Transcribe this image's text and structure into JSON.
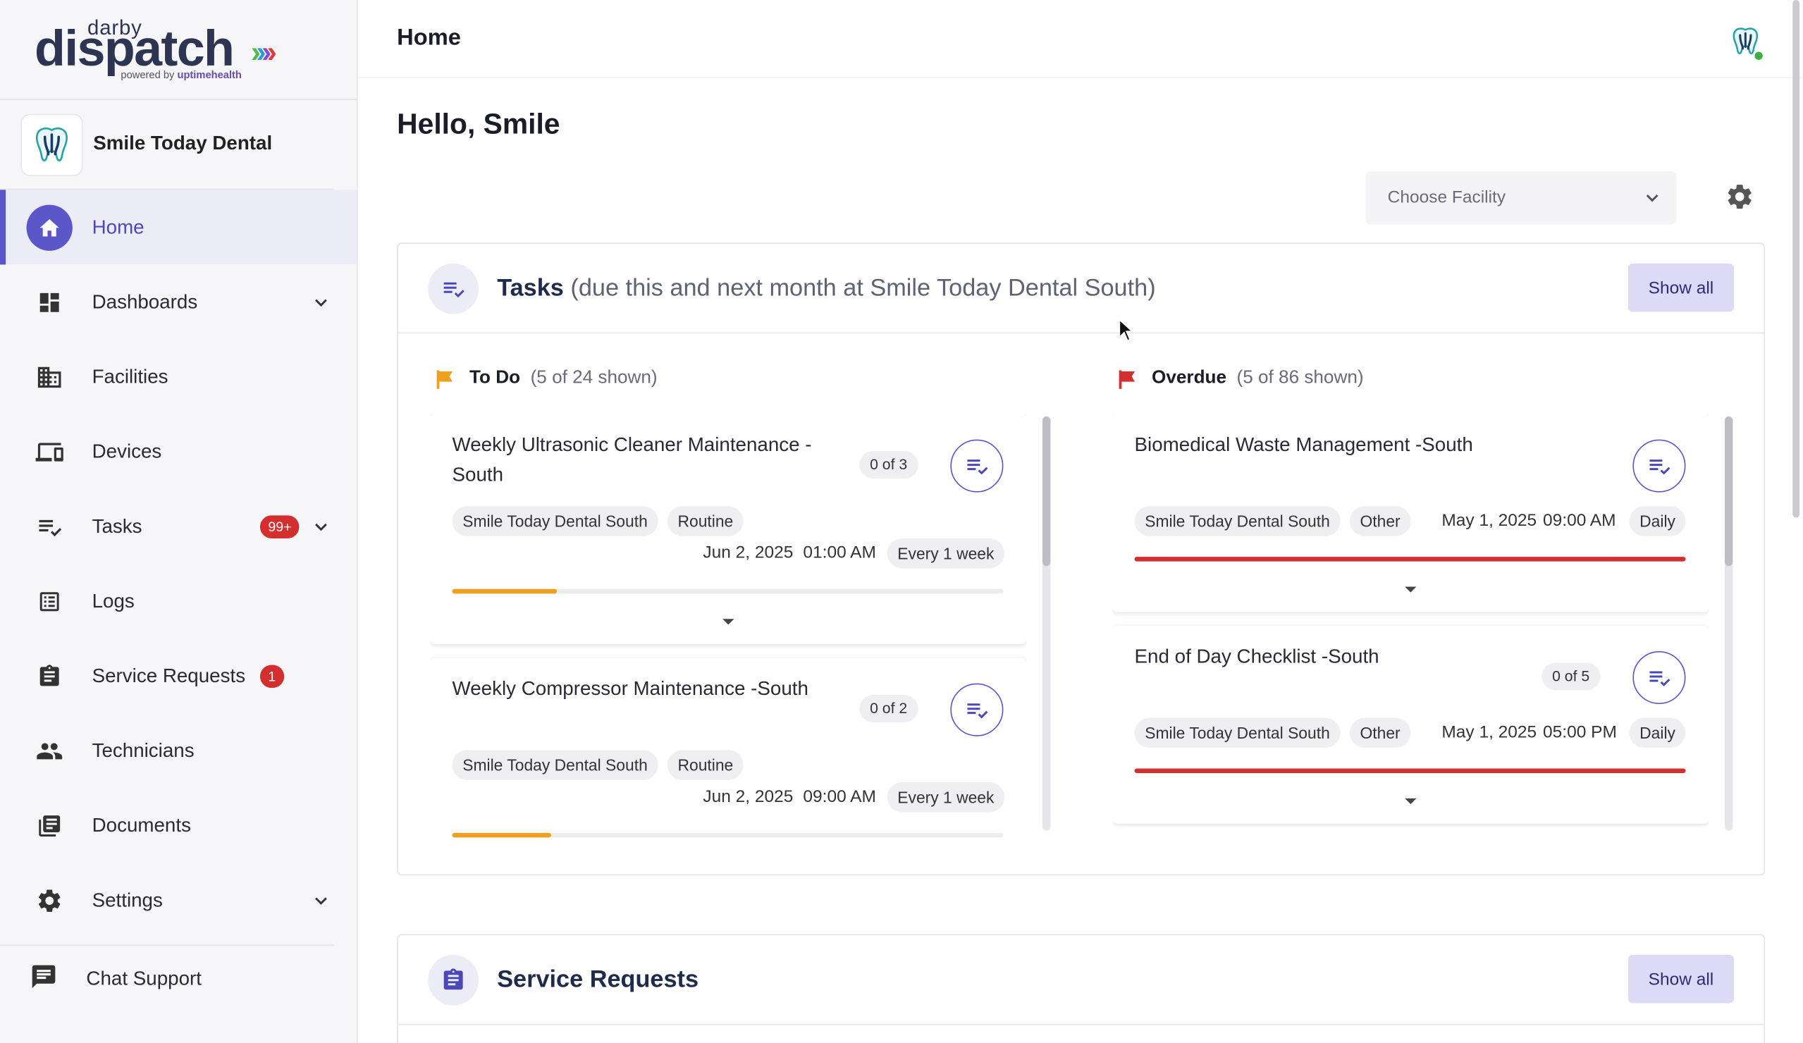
{
  "brand": {
    "logo_top": "darby",
    "logo_main": "dispatch",
    "logo_arrows": [
      "›",
      "›",
      "›",
      "›"
    ],
    "powered_prefix": "powered by",
    "powered_name": "uptimehealth"
  },
  "org": {
    "name": "Smile Today Dental"
  },
  "nav": {
    "items": [
      {
        "label": "Home",
        "icon": "home-icon",
        "active": true
      },
      {
        "label": "Dashboards",
        "icon": "dashboard-icon",
        "chevron": true
      },
      {
        "label": "Facilities",
        "icon": "building-icon"
      },
      {
        "label": "Devices",
        "icon": "devices-icon"
      },
      {
        "label": "Tasks",
        "icon": "tasks-icon",
        "badge": "99+",
        "chevron": true
      },
      {
        "label": "Logs",
        "icon": "logs-icon"
      },
      {
        "label": "Service Requests",
        "icon": "clipboard-icon",
        "badge": "1"
      },
      {
        "label": "Technicians",
        "icon": "people-icon"
      },
      {
        "label": "Documents",
        "icon": "documents-icon"
      },
      {
        "label": "Settings",
        "icon": "gear-icon",
        "chevron": true
      }
    ],
    "chat_support": "Chat Support"
  },
  "header": {
    "title": "Home"
  },
  "greeting": "Hello, Smile",
  "facility_select": {
    "placeholder": "Choose Facility"
  },
  "tasks_card": {
    "title": "Tasks",
    "subtitle": "(due this and next month at Smile Today Dental South)",
    "show_all": "Show all",
    "todo": {
      "title": "To Do",
      "count_text": "(5 of 24 shown)",
      "flag_color": "#f0a020",
      "items": [
        {
          "name": "Weekly Ultrasonic Cleaner Maintenance -South",
          "count": "0 of 3",
          "facility": "Smile Today Dental South",
          "category": "Routine",
          "date": "Jun 2, 2025",
          "time": "01:00 AM",
          "frequency": "Every 1 week",
          "progress": 0.19,
          "progress_color": "#f0a020"
        },
        {
          "name": "Weekly Compressor Maintenance -South",
          "count": "0 of 2",
          "facility": "Smile Today Dental South",
          "category": "Routine",
          "date": "Jun 2, 2025",
          "time": "09:00 AM",
          "frequency": "Every 1 week",
          "progress": 0.18,
          "progress_color": "#f0a020"
        }
      ]
    },
    "overdue": {
      "title": "Overdue",
      "count_text": "(5 of 86 shown)",
      "flag_color": "#d32f2f",
      "items": [
        {
          "name": "Biomedical Waste Management -South",
          "count": "",
          "facility": "Smile Today Dental South",
          "category": "Other",
          "date": "May 1, 2025",
          "time": "09:00 AM",
          "frequency": "Daily",
          "progress": 1.0,
          "progress_color": "#d32f2f"
        },
        {
          "name": "End of Day Checklist -South",
          "count": "0 of 5",
          "facility": "Smile Today Dental South",
          "category": "Other",
          "date": "May 1, 2025",
          "time": "05:00 PM",
          "frequency": "Daily",
          "progress": 1.0,
          "progress_color": "#d32f2f"
        }
      ]
    }
  },
  "service_card": {
    "title": "Service Requests",
    "show_all": "Show all"
  },
  "colors": {
    "accent": "#5b57c9",
    "badge": "#d32f2f",
    "status_online": "#3cb043"
  }
}
